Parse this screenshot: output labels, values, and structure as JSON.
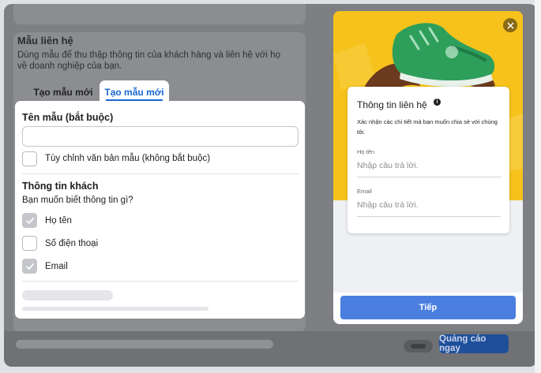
{
  "background": {
    "section_title": "Mẫu liên hệ",
    "section_desc": "Dùng mẫu để thu thập thông tin của khách hàng và liên hệ với họ về doanh nghiệp của bạn.",
    "cta_label": "Quảng cáo ngay"
  },
  "tabs": [
    {
      "label": "Tạo mẫu mới",
      "active": false
    },
    {
      "label": "Tạo mẫu mới",
      "active": true
    }
  ],
  "form": {
    "name_label": "Tên mẫu (bắt buộc)",
    "name_value": "",
    "custom_text_label": "Tùy chỉnh văn bản mẫu (không bắt buộc)",
    "custom_text_checked": false,
    "customer_info_title": "Thông tin khách",
    "customer_info_question": "Bạn muốn biết thông tin gì?",
    "fields": [
      {
        "label": "Họ tên",
        "checked": true
      },
      {
        "label": "Số điện thoại",
        "checked": false
      },
      {
        "label": "Email",
        "checked": true
      }
    ]
  },
  "preview": {
    "card_title": "Thông tin liên hệ",
    "card_desc": "Xác nhận các chi tiết mà bạn muốn chia sẻ với chúng tôi:",
    "fields": [
      {
        "label": "Họ tên",
        "placeholder": "Nhập câu trả lời."
      },
      {
        "label": "Email",
        "placeholder": "Nhập câu trả lời."
      }
    ],
    "next_label": "Tiếp"
  },
  "colors": {
    "accent": "#1967d2",
    "hero_yellow": "#f6c21b",
    "next_button": "#4a7fe0",
    "shoe_green": "#2e9e5b"
  },
  "icons": [
    "close-icon",
    "info-icon",
    "checkmark-icon"
  ]
}
